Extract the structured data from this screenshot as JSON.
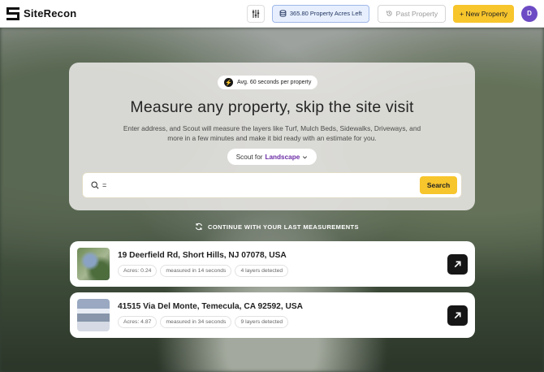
{
  "header": {
    "brand": "SiteRecon",
    "acres_left": "365.80 Property Acres Left",
    "past_property": "Past Property",
    "new_property": "+ New Property",
    "avatar_initial": "D"
  },
  "hero": {
    "badge": "Avg. 60 seconds per property",
    "title": "Measure any property, skip the site visit",
    "subtitle": "Enter address, and Scout will measure the layers like Turf, Mulch Beds, Sidewalks, Driveways, and more in a few minutes and make it bid ready with an estimate for you.",
    "scout_prefix": "Scout for",
    "scout_value": "Landscape",
    "search_value": "=",
    "search_placeholder": "",
    "search_button": "Search"
  },
  "continue_label": "CONTINUE WITH YOUR LAST MEASUREMENTS",
  "measurements": [
    {
      "address": "19 Deerfield Rd, Short Hills, NJ 07078, USA",
      "acres": "Acres: 0.24",
      "measured": "measured in 14 seconds",
      "layers": "4 layers detected"
    },
    {
      "address": "41515 Via Del Monte, Temecula, CA 92592, USA",
      "acres": "Acres: 4.87",
      "measured": "measured in 34 seconds",
      "layers": "9 layers detected"
    }
  ],
  "colors": {
    "accent_yellow": "#f7c52c",
    "scout_purple": "#6c2ea6",
    "avatar_purple": "#6d4bc4"
  }
}
